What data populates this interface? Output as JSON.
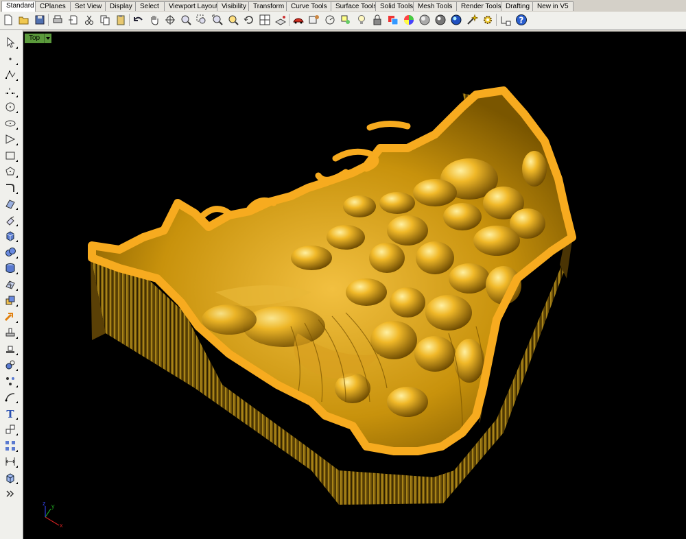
{
  "tabs": [
    {
      "label": "Standard",
      "active": true
    },
    {
      "label": "CPlanes"
    },
    {
      "label": "Set View"
    },
    {
      "label": "Display"
    },
    {
      "label": "Select"
    },
    {
      "label": "Viewport Layout"
    },
    {
      "label": "Visibility"
    },
    {
      "label": "Transform"
    },
    {
      "label": "Curve Tools"
    },
    {
      "label": "Surface Tools"
    },
    {
      "label": "Solid Tools"
    },
    {
      "label": "Mesh Tools"
    },
    {
      "label": "Render Tools"
    },
    {
      "label": "Drafting"
    },
    {
      "label": "New in V5"
    }
  ],
  "toolbar_icons": [
    "new-file-icon",
    "open-folder-icon",
    "save-icon",
    "print-icon",
    "import-icon",
    "cut-icon",
    "copy-icon",
    "paste-icon",
    "undo-icon",
    "pan-hand-icon",
    "rotate-view-icon",
    "zoom-dynamic-icon",
    "zoom-window-icon",
    "zoom-extents-icon",
    "zoom-selected-icon",
    "undo-view-icon",
    "four-viewports-icon",
    "cplane-icon",
    "car-render-icon",
    "pick-points-icon",
    "distance-icon",
    "osnap-icon",
    "light-bulb-icon",
    "lock-icon",
    "layers-icon",
    "color-wheel-icon",
    "shaded-sphere-icon",
    "rendered-sphere-icon",
    "render-icon",
    "wand-icon",
    "settings-gear-icon",
    "curve-dimension-icon",
    "help-icon"
  ],
  "left_toolbar_icons": [
    "select-arrow-icon",
    "point-icon",
    "polyline-icon",
    "curve-icon",
    "circle-icon",
    "ellipse-icon",
    "polygon-tool-icon",
    "rectangle-icon",
    "polygon-icon",
    "fillet-curve-icon",
    "surface-icon",
    "extrude-surface-icon",
    "box-solid-icon",
    "sphere-solid-icon",
    "cylinder-solid-icon",
    "mesh-icon",
    "boolean-icon",
    "arrow-move-icon",
    "gumball-icon",
    "align-icon",
    "analyze-icon",
    "group-icon",
    "curve-arc-icon",
    "text-icon",
    "scale-icon",
    "array-icon",
    "dimension-icon",
    "block-icon",
    "more-icon"
  ],
  "viewport": {
    "label": "Top",
    "background": "#000000",
    "model_color": "#f0b020"
  },
  "axes": {
    "x": "x",
    "y": "y",
    "z": "z"
  },
  "colors": {
    "tab_active": "#ffffff",
    "viewport_label_bg": "#5b9a3c"
  }
}
